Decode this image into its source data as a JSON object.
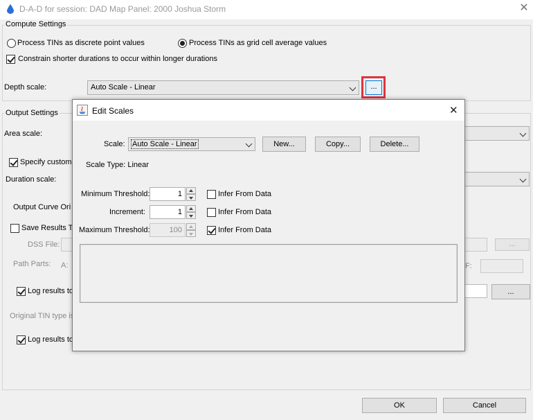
{
  "window": {
    "title": "D-A-D for session: DAD   Map Panel: 2000 Joshua Storm",
    "close_glyph": "✕"
  },
  "compute": {
    "legend": "Compute Settings",
    "radio_discrete": "Process TINs as discrete point values",
    "radio_grid": "Process TINs as grid cell average values",
    "constrain": "Constrain shorter durations to occur within longer durations",
    "depth_scale_label": "Depth scale:",
    "depth_scale_value": "Auto Scale - Linear",
    "ellipsis": "..."
  },
  "output": {
    "legend": "Output Settings",
    "area_scale_label": "Area scale:",
    "specify_custom": "Specify custom",
    "duration_scale_label": "Duration scale:",
    "output_curve": "Output Curve Ori",
    "save_results": "Save Results T",
    "dss_file": "DSS File:",
    "path_parts": "Path Parts:",
    "part_a": "A:",
    "part_f": "F:",
    "log_results_1": "Log results to",
    "original_tin": "Original TIN type is",
    "log_results_2": "Log results to",
    "ellipsis": "..."
  },
  "footer": {
    "ok": "OK",
    "cancel": "Cancel"
  },
  "dialog": {
    "title": "Edit Scales",
    "close_glyph": "✕",
    "scale_label": "Scale:",
    "scale_value": "Auto Scale - Linear",
    "new": "New...",
    "copy": "Copy...",
    "delete": "Delete...",
    "scale_type": "Scale Type: Linear",
    "min_label": "Minimum Threshold:",
    "min_value": "1",
    "inc_label": "Increment:",
    "inc_value": "1",
    "max_label": "Maximum Threshold:",
    "max_value": "100",
    "infer": "Infer From Data"
  },
  "colors": {
    "highlight": "#e0333b",
    "drop_icon": "#2a6fd6"
  }
}
